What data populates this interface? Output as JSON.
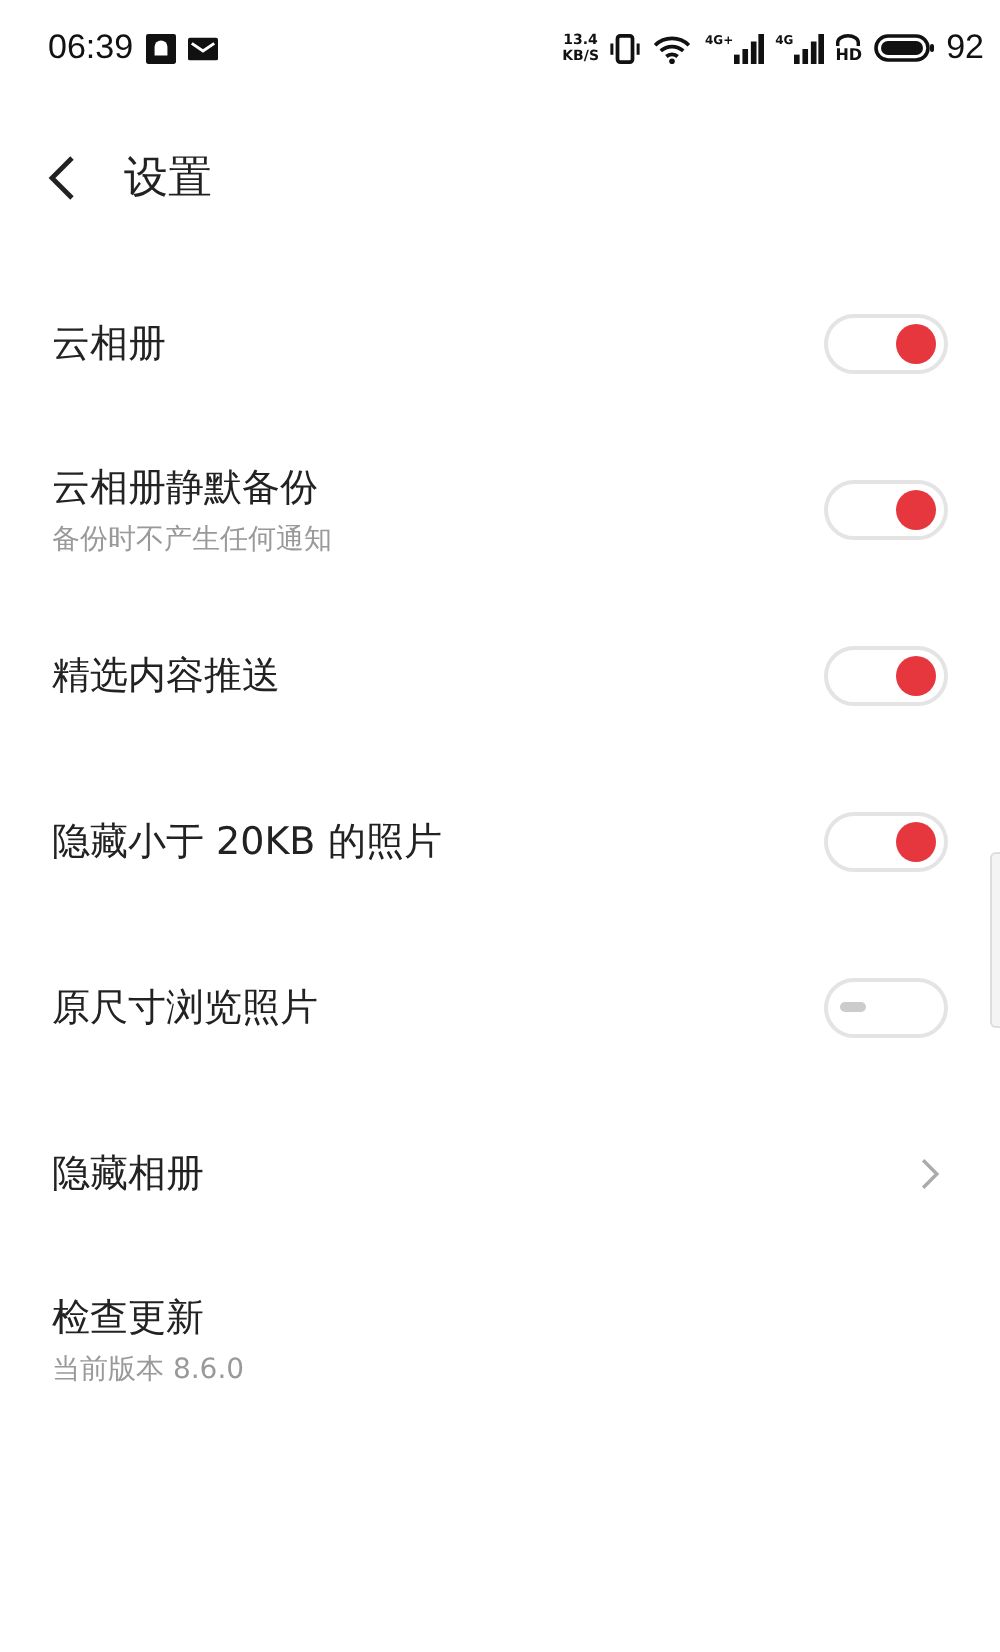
{
  "status_bar": {
    "time": "06:39",
    "net_speed": "13.4",
    "net_unit": "KB/S",
    "signal_labels": [
      "4G+",
      "4G"
    ],
    "hd": "HD",
    "battery": "92"
  },
  "header": {
    "title": "设置"
  },
  "settings": [
    {
      "kind": "toggle",
      "label": "云相册",
      "on": true
    },
    {
      "kind": "toggle",
      "label": "云相册静默备份",
      "subtitle": "备份时不产生任何通知",
      "on": true
    },
    {
      "kind": "toggle",
      "label": "精选内容推送",
      "on": true
    },
    {
      "kind": "toggle",
      "label": "隐藏小于 20KB 的照片",
      "on": true
    },
    {
      "kind": "toggle",
      "label": "原尺寸浏览照片",
      "on": false
    },
    {
      "kind": "nav",
      "label": "隐藏相册"
    },
    {
      "kind": "info",
      "label": "检查更新",
      "subtitle": "当前版本 8.6.0"
    }
  ]
}
